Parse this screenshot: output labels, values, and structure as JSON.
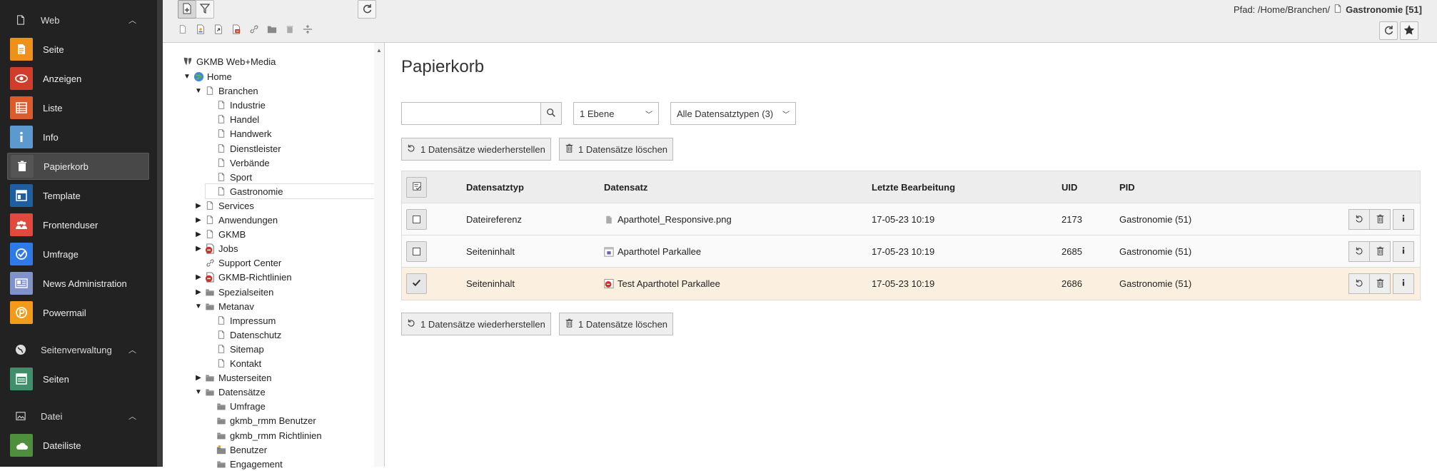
{
  "module_menu": {
    "groups": [
      {
        "label": "Web",
        "icon": "page-icon",
        "chevron": "^"
      },
      {
        "label": "Seitenverwaltung",
        "icon": "globe-icon",
        "chevron": "^"
      },
      {
        "label": "Datei",
        "icon": "image-icon",
        "chevron": "^"
      }
    ],
    "modules": [
      {
        "label": "Seite",
        "icon": "page-module-icon",
        "color": "#f18f1b"
      },
      {
        "label": "Anzeigen",
        "icon": "eye-icon",
        "color": "#d23c2b"
      },
      {
        "label": "Liste",
        "icon": "list-icon",
        "color": "#dd5a2a"
      },
      {
        "label": "Info",
        "icon": "info-icon",
        "color": "#5c99cf"
      },
      {
        "label": "Papierkorb",
        "icon": "trash-icon",
        "color": "#555555"
      },
      {
        "label": "Template",
        "icon": "template-icon",
        "color": "#1d5fa0"
      },
      {
        "label": "Frontenduser",
        "icon": "users-icon",
        "color": "#e2493d"
      },
      {
        "label": "Umfrage",
        "icon": "check-icon",
        "color": "#2e7ae8"
      },
      {
        "label": "News Administration",
        "icon": "news-icon",
        "color": "#7f92c9"
      },
      {
        "label": "Powermail",
        "icon": "powermail-icon",
        "color": "#f39a1b"
      },
      {
        "label": "Seiten",
        "icon": "pages-icon",
        "color": "#3f8f6b"
      },
      {
        "label": "Dateiliste",
        "icon": "filelist-icon",
        "color": "#4f8e3d"
      }
    ]
  },
  "path": {
    "prefix": "Pfad: /Home/Branchen/",
    "current": "Gastronomie [51]"
  },
  "tree": {
    "root": "GKMB Web+Media",
    "nodes": [
      {
        "label": "Home",
        "tog": "▼",
        "icon": "globe-page-icon"
      },
      {
        "label": "Branchen",
        "tog": "▼",
        "icon": "page-icon"
      },
      {
        "label": "Industrie",
        "tog": "",
        "icon": "page-icon"
      },
      {
        "label": "Handel",
        "tog": "",
        "icon": "page-icon"
      },
      {
        "label": "Handwerk",
        "tog": "",
        "icon": "page-icon"
      },
      {
        "label": "Dienstleister",
        "tog": "",
        "icon": "page-icon"
      },
      {
        "label": "Verbände",
        "tog": "",
        "icon": "page-icon"
      },
      {
        "label": "Sport",
        "tog": "",
        "icon": "page-icon"
      },
      {
        "label": "Gastronomie",
        "tog": "",
        "icon": "page-icon"
      },
      {
        "label": "Services",
        "tog": "▶",
        "icon": "page-icon"
      },
      {
        "label": "Anwendungen",
        "tog": "▶",
        "icon": "page-icon"
      },
      {
        "label": "GKMB",
        "tog": "▶",
        "icon": "page-icon"
      },
      {
        "label": "Jobs",
        "tog": "▶",
        "icon": "page-hidden-icon"
      },
      {
        "label": "Support Center",
        "tog": "",
        "icon": "link-icon"
      },
      {
        "label": "GKMB-Richtlinien",
        "tog": "▶",
        "icon": "page-hidden-icon"
      },
      {
        "label": "Spezialseiten",
        "tog": "▶",
        "icon": "folder-icon"
      },
      {
        "label": "Metanav",
        "tog": "▼",
        "icon": "folder-icon"
      },
      {
        "label": "Impressum",
        "tog": "",
        "icon": "page-icon"
      },
      {
        "label": "Datenschutz",
        "tog": "",
        "icon": "page-icon"
      },
      {
        "label": "Sitemap",
        "tog": "",
        "icon": "page-icon"
      },
      {
        "label": "Kontakt",
        "tog": "",
        "icon": "page-icon"
      },
      {
        "label": "Musterseiten",
        "tog": "▶",
        "icon": "folder-icon"
      },
      {
        "label": "Datensätze",
        "tog": "▼",
        "icon": "folder-icon"
      },
      {
        "label": "Umfrage",
        "tog": "",
        "icon": "folder-icon"
      },
      {
        "label": "gkmb_rmm Benutzer",
        "tog": "",
        "icon": "folder-icon"
      },
      {
        "label": "gkmb_rmm Richtlinien",
        "tog": "",
        "icon": "folder-icon"
      },
      {
        "label": "Benutzer",
        "tog": "",
        "icon": "folder-users-icon"
      },
      {
        "label": "Engagement",
        "tog": "",
        "icon": "folder-icon"
      }
    ]
  },
  "main": {
    "title": "Papierkorb",
    "search_placeholder": "",
    "depth_select": "1 Ebene",
    "type_select": "Alle Datensatztypen (3)",
    "restore_label": "1 Datensätze wiederherstellen",
    "delete_label": "1 Datensätze löschen",
    "columns": [
      "Datensatztyp",
      "Datensatz",
      "Letzte Bearbeitung",
      "UID",
      "PID"
    ],
    "rows": [
      {
        "type": "Dateireferenz",
        "record": "Aparthotel_Responsive.png",
        "icon": "file-icon",
        "date": "17-05-23 10:19",
        "uid": "2173",
        "pid": "Gastronomie (51)",
        "checked": false
      },
      {
        "type": "Seiteninhalt",
        "record": "Aparthotel Parkallee",
        "icon": "content-icon",
        "date": "17-05-23 10:19",
        "uid": "2685",
        "pid": "Gastronomie (51)",
        "checked": false
      },
      {
        "type": "Seiteninhalt",
        "record": "Test Aparthotel Parkallee",
        "icon": "content-hidden-icon",
        "date": "17-05-23 10:19",
        "uid": "2686",
        "pid": "Gastronomie (51)",
        "checked": true
      }
    ]
  }
}
